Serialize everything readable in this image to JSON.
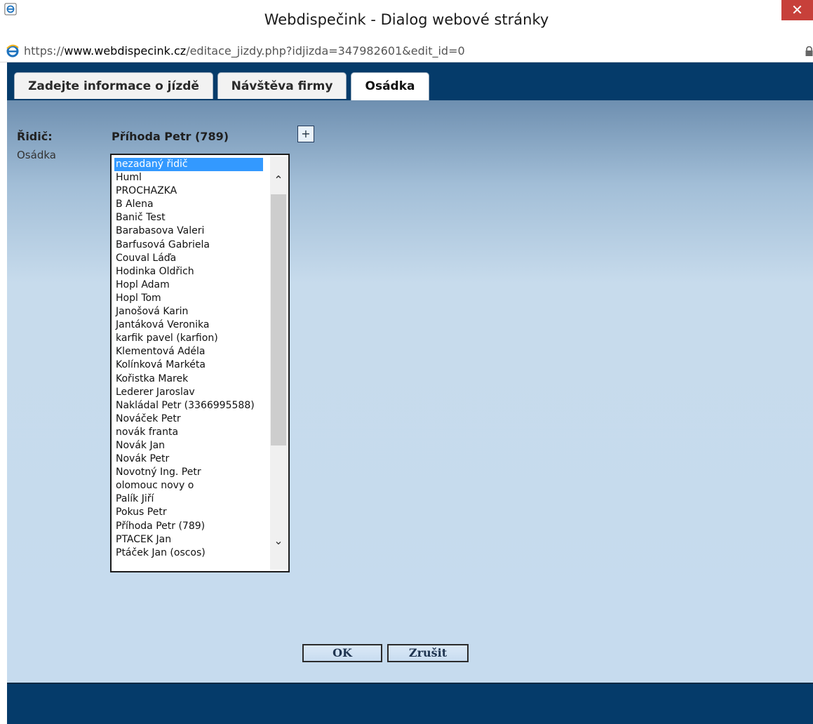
{
  "window": {
    "title": "Webdispečink - Dialog webové stránky",
    "close_glyph": "✕"
  },
  "address_bar": {
    "url_scheme": "https://",
    "url_domain": "www.webdispecink.cz",
    "url_path": "/editace_jizdy.php?idjizda=347982601&edit_id=0"
  },
  "tabs": [
    {
      "label": "Zadejte informace o jízdě",
      "active": false
    },
    {
      "label": "Návštěva firmy",
      "active": false
    },
    {
      "label": "Osádka",
      "active": true
    }
  ],
  "form": {
    "ridic_label": "Řidič:",
    "ridic_value": "Příhoda Petr (789)",
    "add_glyph": "+",
    "osadka_label": "Osádka"
  },
  "crew_list": {
    "selected_index": 0,
    "items": [
      "nezadaný řidič",
      "Huml",
      "PROCHAZKA",
      "B Alena",
      "Banič Test",
      "Barabasova Valeri",
      "Barfusová Gabriela",
      "Couval Láďa",
      "Hodinka Oldřich",
      "Hopl Adam",
      "Hopl Tom",
      "Janošová Karin",
      "Jantáková Veronika",
      "karfik pavel (karfion)",
      "Klementová Adéla",
      "Kolínková Markéta",
      "Kořistka Marek",
      "Lederer Jaroslav",
      "Nakládal Petr (3366995588)",
      "Nováček Petr",
      "novák franta",
      "Novák Jan",
      "Novák Petr",
      "Novotný Ing. Petr",
      "olomouc novy o",
      "Palík Jiří",
      "Pokus Petr",
      "Příhoda Petr (789)",
      "PTACEK Jan",
      "Ptáček Jan (oscos)"
    ],
    "scroll_up_glyph": "⌃",
    "scroll_down_glyph": "⌄"
  },
  "buttons": {
    "ok_label": "OK",
    "cancel_label": "Zrušit"
  }
}
